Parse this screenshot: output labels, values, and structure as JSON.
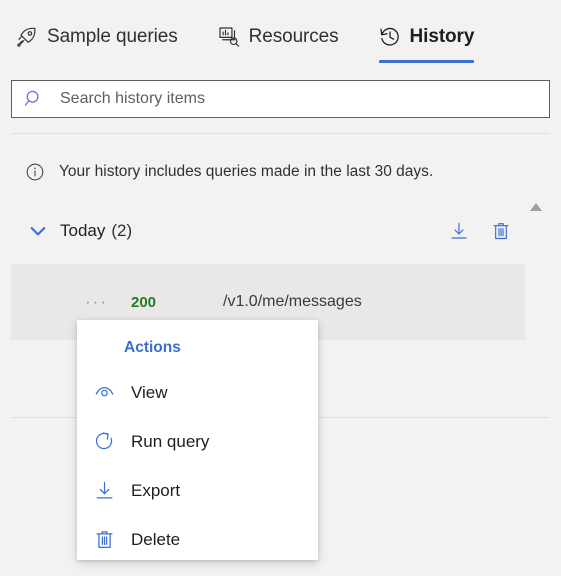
{
  "tabs": [
    {
      "id": "sample-queries",
      "label": "Sample queries",
      "icon": "rocket-icon",
      "active": false
    },
    {
      "id": "resources",
      "label": "Resources",
      "icon": "resources-icon",
      "active": false
    },
    {
      "id": "history",
      "label": "History",
      "icon": "history-clock-icon",
      "active": true
    }
  ],
  "search": {
    "placeholder": "Search history items",
    "value": "",
    "icon": "search-icon"
  },
  "info": {
    "icon": "info-circle-icon",
    "text": "Your history includes queries made in the last 30 days."
  },
  "group": {
    "chevron": "chevron-down-icon",
    "title": "Today",
    "count": "(2)",
    "actions": [
      {
        "id": "download-group",
        "icon": "download-icon"
      },
      {
        "id": "delete-group",
        "icon": "trash-icon"
      }
    ]
  },
  "scrollbar": {
    "up_arrow": "scroll-up-arrow-icon"
  },
  "rows": [
    {
      "ellipsis": "···",
      "status": "200",
      "path": "/v1.0/me/messages",
      "selected": true
    },
    {
      "ellipsis": "",
      "status": "",
      "path": "",
      "selected": false
    }
  ],
  "context_menu": {
    "heading": "Actions",
    "items": [
      {
        "id": "view",
        "label": "View",
        "icon": "eye-icon"
      },
      {
        "id": "run-query",
        "label": "Run query",
        "icon": "refresh-icon"
      },
      {
        "id": "export",
        "label": "Export",
        "icon": "download-icon"
      },
      {
        "id": "delete",
        "label": "Delete",
        "icon": "trash-icon"
      }
    ]
  },
  "colors": {
    "accent": "#3b6fce",
    "status_success": "#237b24",
    "background": "#f3f2f1",
    "row_selected": "#e9e8e7"
  }
}
